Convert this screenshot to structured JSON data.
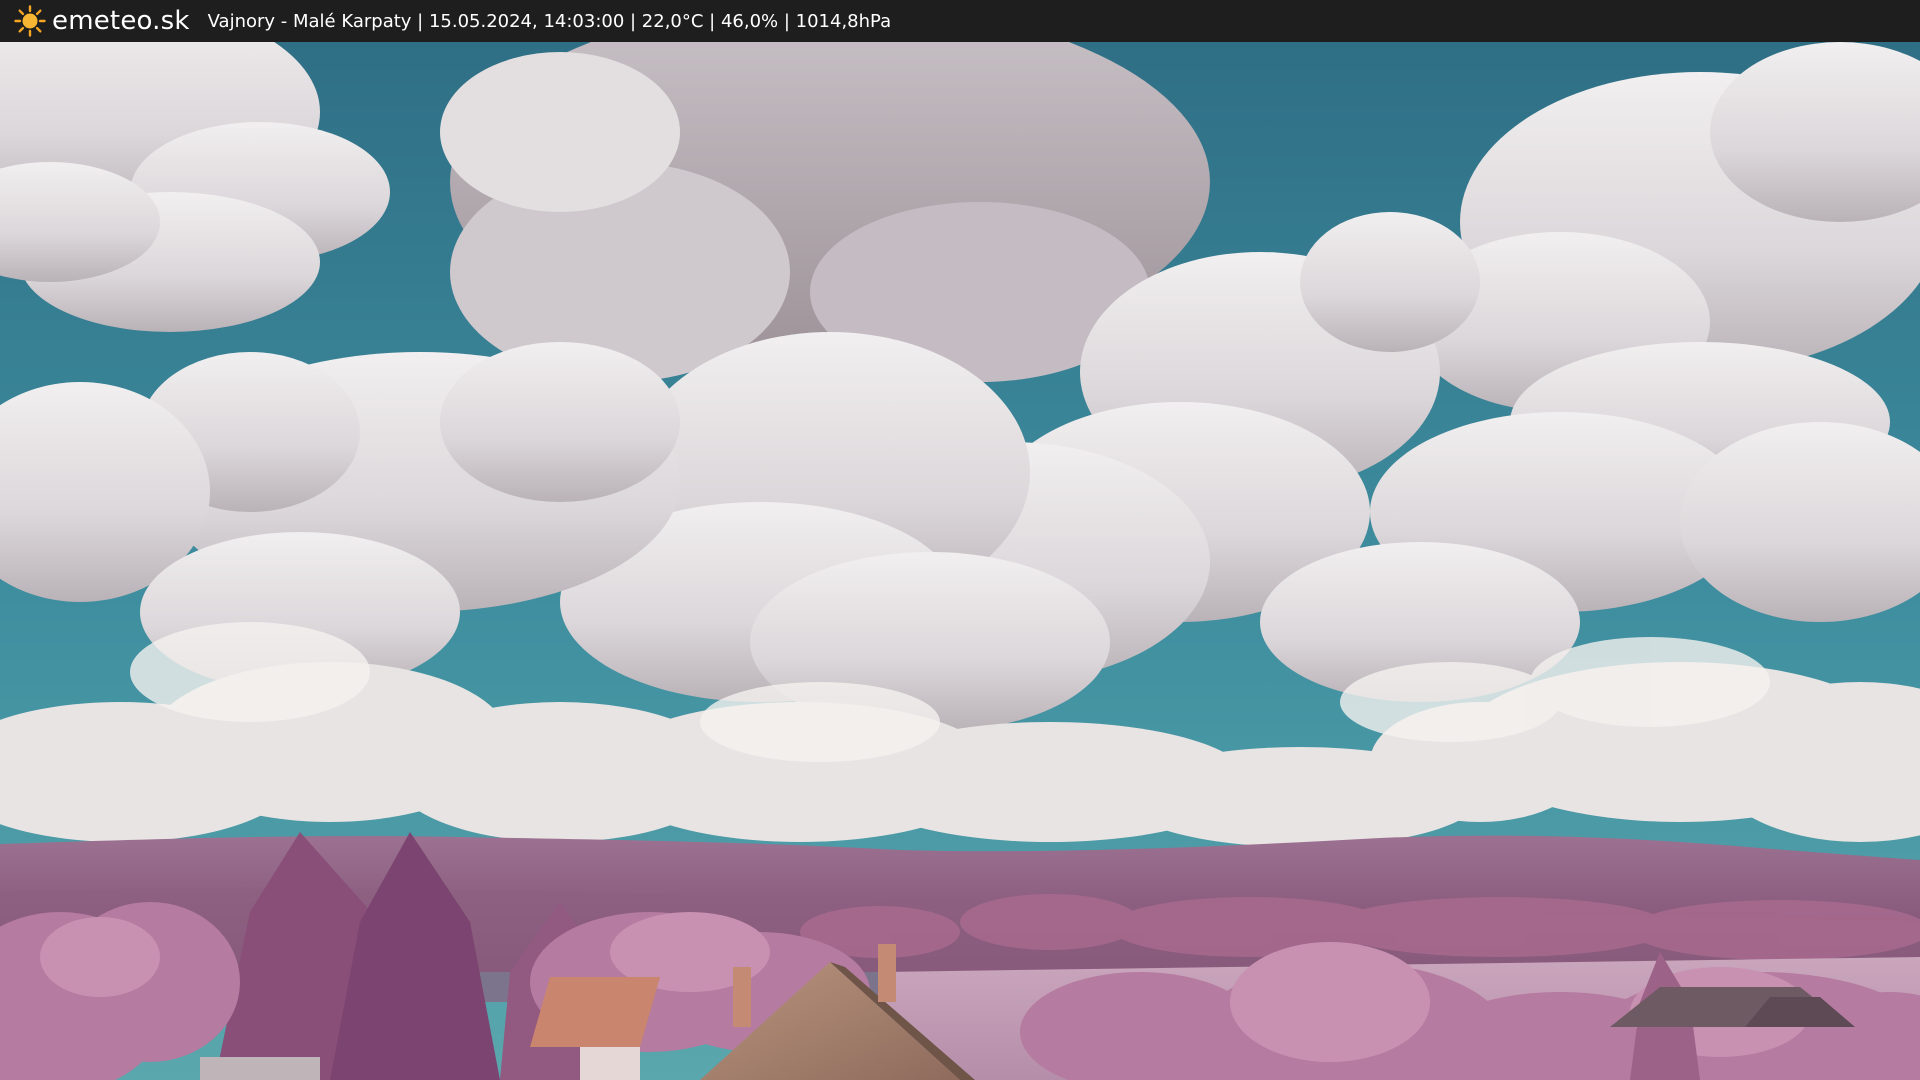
{
  "header": {
    "brand": "emeteo.sk",
    "logo_icon": "sun-icon",
    "caption": "Vajnory - Malé Karpaty | 15.05.2024, 14:03:00 | 22,0°C | 46,0% | 1014,8hPa"
  },
  "colors": {
    "bar_bg": "#1e1e1e",
    "bar_text": "#ffffff",
    "sun": "#f5a623",
    "sky": "#3f8fa0",
    "foliage_infrared": "#b98aa8"
  }
}
